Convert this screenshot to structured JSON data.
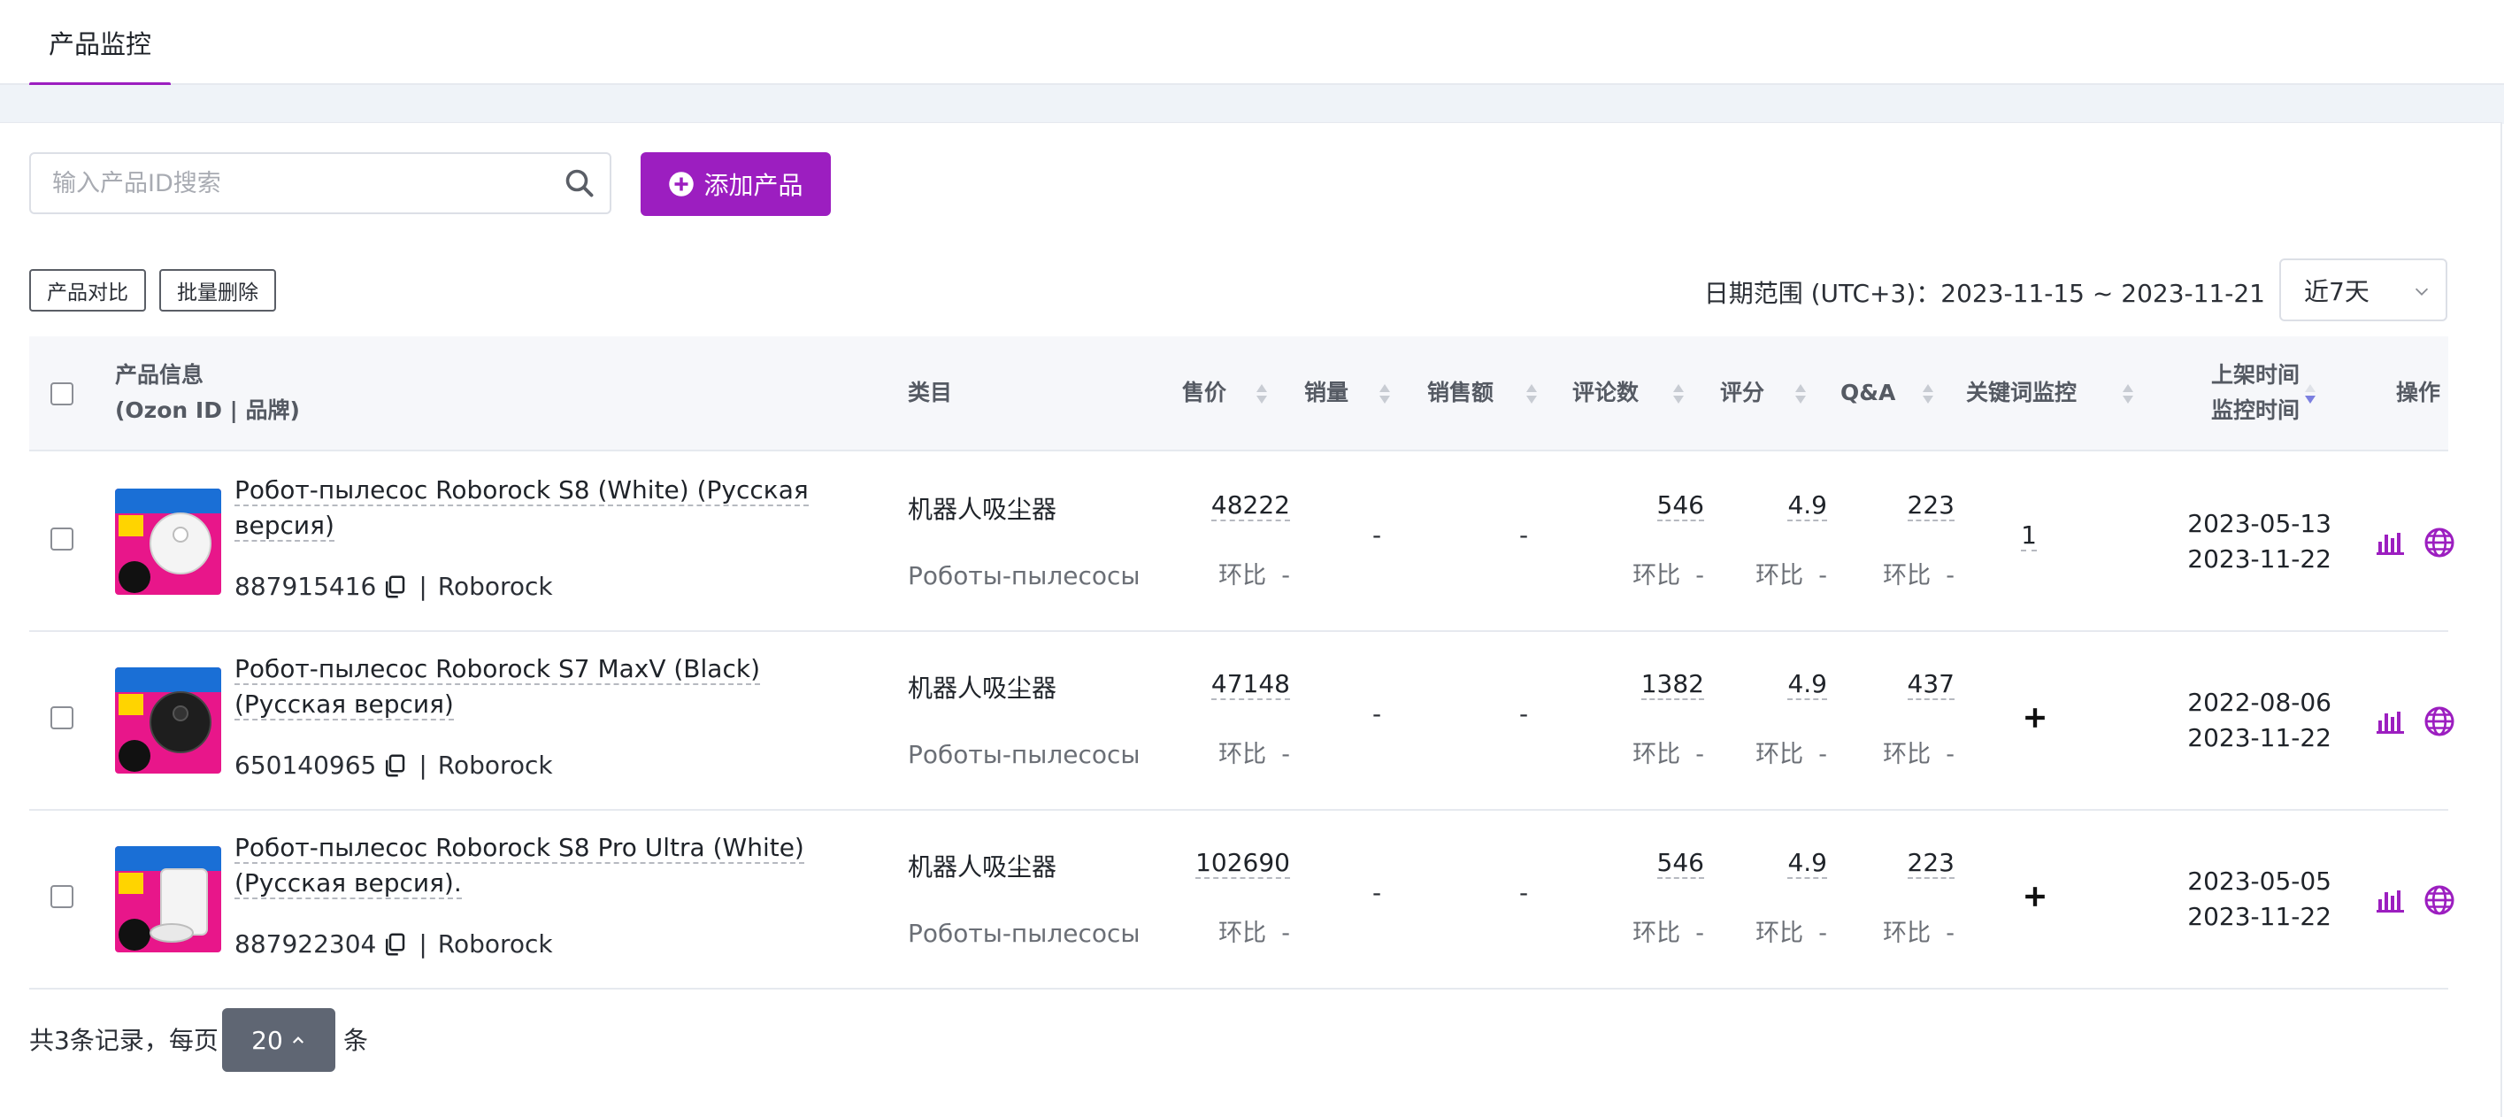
{
  "tabs": [
    {
      "label": "产品监控",
      "active": true
    }
  ],
  "search": {
    "placeholder": "输入产品ID搜索",
    "value": ""
  },
  "toolbar": {
    "add_label": "添加产品",
    "compare_label": "产品对比",
    "bulk_delete_label": "批量删除"
  },
  "date_range": {
    "label": "日期范围 (UTC+3)：",
    "start": "2023-11-15",
    "separator": " ~ ",
    "end": "2023-11-21"
  },
  "period": {
    "selected": "近7天"
  },
  "table": {
    "headers": {
      "product_info_line1": "产品信息",
      "product_info_line2": "(Ozon ID | 品牌)",
      "category": "类目",
      "price": "售价",
      "sales": "销量",
      "revenue": "销售额",
      "reviews": "评论数",
      "rating": "评分",
      "qa": "Q&A",
      "keyword_monitor": "关键词监控",
      "list_time": "上架时间",
      "monitor_time": "监控时间",
      "actions": "操作"
    },
    "ratio_label": "环比  -",
    "rows": [
      {
        "name": "Робот-пылесос Roborock S8 (White) (Русская версия)",
        "ozon_id": "887915416",
        "brand": "Roborock",
        "category_zh": "机器人吸尘器",
        "category_ru": "Роботы-пылесосы",
        "price": "48222",
        "sales": "-",
        "revenue": "-",
        "reviews": "546",
        "rating": "4.9",
        "qa": "223",
        "keyword_count": "1",
        "list_date": "2023-05-13",
        "monitor_date": "2023-11-22",
        "thumb": {
          "bg": "#e8168a",
          "top": "#1a6fd6",
          "product": "white"
        }
      },
      {
        "name": "Робот-пылесос Roborock S7 MaxV (Black) (Русская версия)",
        "ozon_id": "650140965",
        "brand": "Roborock",
        "category_zh": "机器人吸尘器",
        "category_ru": "Роботы-пылесосы",
        "price": "47148",
        "sales": "-",
        "revenue": "-",
        "reviews": "1382",
        "rating": "4.9",
        "qa": "437",
        "keyword_count": "",
        "list_date": "2022-08-06",
        "monitor_date": "2023-11-22",
        "thumb": {
          "bg": "#e8168a",
          "top": "#1a6fd6",
          "product": "black"
        }
      },
      {
        "name": "Робот-пылесос Roborock S8 Pro Ultra (White) (Русская версия).",
        "ozon_id": "887922304",
        "brand": "Roborock",
        "category_zh": "机器人吸尘器",
        "category_ru": "Роботы-пылесосы",
        "price": "102690",
        "sales": "-",
        "revenue": "-",
        "reviews": "546",
        "rating": "4.9",
        "qa": "223",
        "keyword_count": "",
        "list_date": "2023-05-05",
        "monitor_date": "2023-11-22",
        "thumb": {
          "bg": "#e8168a",
          "top": "#1a6fd6",
          "product": "station"
        }
      }
    ]
  },
  "pagination": {
    "total_text": "共3条记录，每页",
    "page_size": "20",
    "suffix": "条"
  },
  "colors": {
    "accent": "#9c1ec0",
    "sort_active": "#7b7fe0",
    "pager_bg": "#5f6673"
  }
}
